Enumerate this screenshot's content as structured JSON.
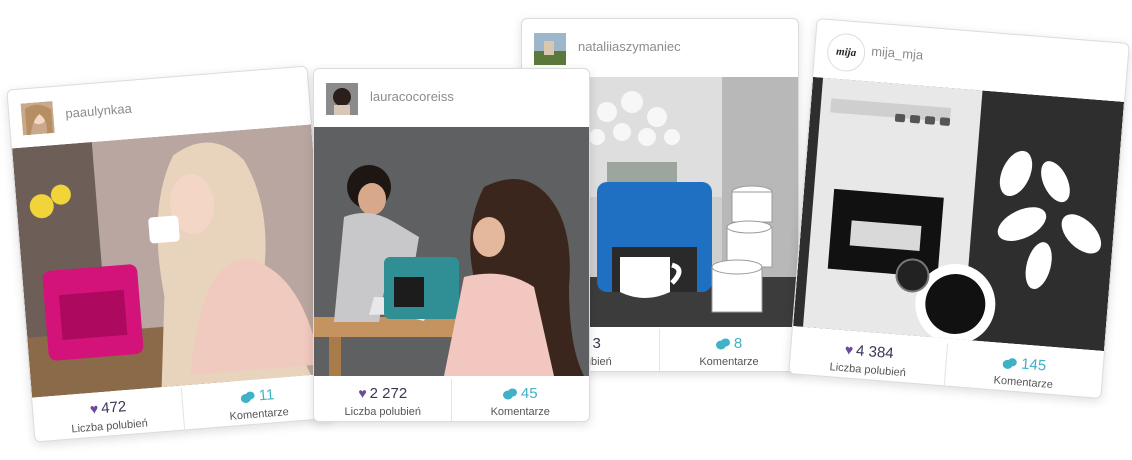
{
  "posts": [
    {
      "username": "paaulynkaa",
      "likes": "472",
      "likes_label": "Liczba polubień",
      "comments": "11",
      "comments_label": "Komentarze",
      "machine_color": "#d3127a"
    },
    {
      "username": "lauracocoreiss",
      "likes": "2 272",
      "likes_label": "Liczba polubień",
      "comments": "45",
      "comments_label": "Komentarze",
      "machine_color": "#2f8f94"
    },
    {
      "username": "nataliiaszymaniec",
      "likes": "3",
      "likes_label": "polubień",
      "comments": "8",
      "comments_label": "Komentarze",
      "machine_color": "#1f6fc2"
    },
    {
      "username": "mija_mja",
      "likes": "4 384",
      "likes_label": "Liczba polubień",
      "comments": "145",
      "comments_label": "Komentarze",
      "machine_color": "#e8e8e8"
    }
  ],
  "logo_text": "mija",
  "colors": {
    "heart": "#6b4a9c",
    "comments": "#3fb2c8"
  }
}
